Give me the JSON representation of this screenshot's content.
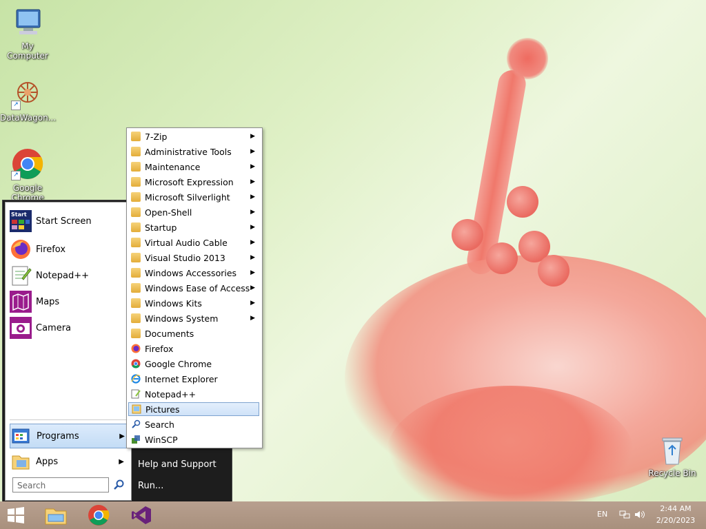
{
  "desktop": {
    "icons": [
      {
        "label": "My Computer",
        "icon": "computer-icon"
      },
      {
        "label": "DataWagon...",
        "icon": "datawagon-icon"
      },
      {
        "label": "Google Chrome",
        "icon": "chrome-icon"
      },
      {
        "label": "Recycle Bin",
        "icon": "recycle-bin-icon"
      }
    ]
  },
  "start_menu": {
    "pinned": [
      {
        "label": "Start Screen",
        "icon": "start-screen-icon"
      },
      {
        "label": "Firefox",
        "icon": "firefox-icon"
      },
      {
        "label": "Notepad++",
        "icon": "notepadpp-icon"
      },
      {
        "label": "Maps",
        "icon": "maps-icon"
      },
      {
        "label": "Camera",
        "icon": "camera-icon"
      }
    ],
    "programs_label": "Programs",
    "apps_label": "Apps",
    "search_placeholder": "Search",
    "right_links": [
      "Help and Support",
      "Run..."
    ]
  },
  "programs_submenu": {
    "items": [
      {
        "label": "7-Zip",
        "icon": "folder-icon",
        "has_submenu": true
      },
      {
        "label": "Administrative Tools",
        "icon": "folder-icon",
        "has_submenu": true
      },
      {
        "label": "Maintenance",
        "icon": "folder-icon",
        "has_submenu": true
      },
      {
        "label": "Microsoft Expression",
        "icon": "folder-icon",
        "has_submenu": true
      },
      {
        "label": "Microsoft Silverlight",
        "icon": "folder-icon",
        "has_submenu": true
      },
      {
        "label": "Open-Shell",
        "icon": "folder-icon",
        "has_submenu": true
      },
      {
        "label": "Startup",
        "icon": "folder-icon",
        "has_submenu": true
      },
      {
        "label": "Virtual Audio Cable",
        "icon": "folder-icon",
        "has_submenu": true
      },
      {
        "label": "Visual Studio 2013",
        "icon": "folder-icon",
        "has_submenu": true
      },
      {
        "label": "Windows Accessories",
        "icon": "folder-icon",
        "has_submenu": true
      },
      {
        "label": "Windows Ease of Access",
        "icon": "folder-icon",
        "has_submenu": true
      },
      {
        "label": "Windows Kits",
        "icon": "folder-icon",
        "has_submenu": true
      },
      {
        "label": "Windows System",
        "icon": "folder-icon",
        "has_submenu": true
      },
      {
        "label": "Documents",
        "icon": "folder-icon",
        "has_submenu": false
      },
      {
        "label": "Firefox",
        "icon": "firefox-icon",
        "has_submenu": false
      },
      {
        "label": "Google Chrome",
        "icon": "chrome-icon",
        "has_submenu": false
      },
      {
        "label": "Internet Explorer",
        "icon": "ie-icon",
        "has_submenu": false
      },
      {
        "label": "Notepad++",
        "icon": "notepadpp-icon",
        "has_submenu": false
      },
      {
        "label": "Pictures",
        "icon": "pictures-icon",
        "has_submenu": false,
        "highlighted": true
      },
      {
        "label": "Search",
        "icon": "search-icon",
        "has_submenu": false
      },
      {
        "label": "WinSCP",
        "icon": "winscp-icon",
        "has_submenu": false
      }
    ]
  },
  "taskbar": {
    "pinned": [
      "windows-start-icon",
      "file-explorer-icon",
      "chrome-icon",
      "visual-studio-icon"
    ],
    "language": "EN",
    "time": "2:44 AM",
    "date": "2/20/2023"
  },
  "colors": {
    "taskbar": "#ad9582",
    "start_menu_dark": "#1d1d1d",
    "highlight": "#cfe2f8"
  }
}
